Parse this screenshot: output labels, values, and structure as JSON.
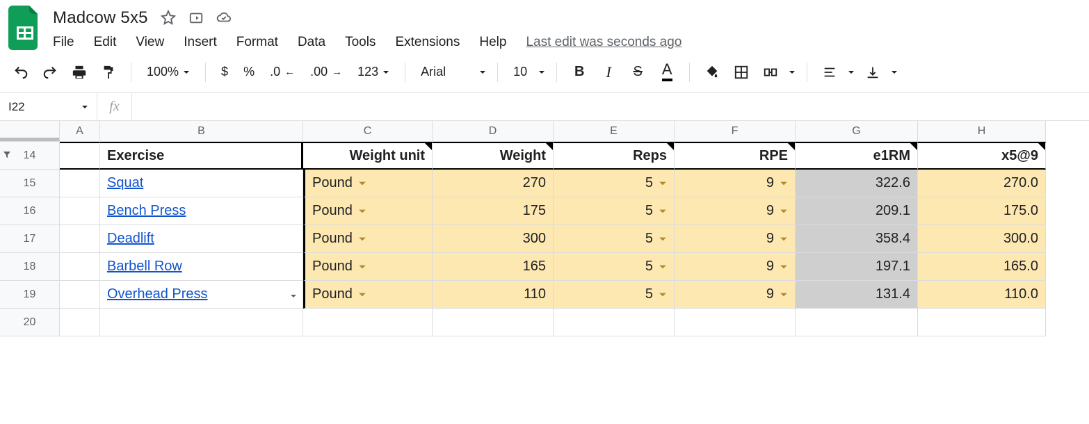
{
  "doc": {
    "title": "Madcow 5x5"
  },
  "menu": {
    "file": "File",
    "edit": "Edit",
    "view": "View",
    "insert": "Insert",
    "format": "Format",
    "data": "Data",
    "tools": "Tools",
    "extensions": "Extensions",
    "help": "Help",
    "last_edit": "Last edit was seconds ago"
  },
  "toolbar": {
    "zoom": "100%",
    "dollar": "$",
    "percent": "%",
    "dec_less": ".0",
    "dec_more": ".00",
    "fmt123": "123",
    "font": "Arial",
    "font_size": "10"
  },
  "namebox": {
    "ref": "I22",
    "fx": "fx"
  },
  "cols": {
    "A": "A",
    "B": "B",
    "C": "C",
    "D": "D",
    "E": "E",
    "F": "F",
    "G": "G",
    "H": "H"
  },
  "rows": {
    "r14": "14",
    "r15": "15",
    "r16": "16",
    "r17": "17",
    "r18": "18",
    "r19": "19",
    "r20": "20"
  },
  "headers": {
    "exercise": "Exercise",
    "unit": "Weight unit",
    "weight": "Weight",
    "reps": "Reps",
    "rpe": "RPE",
    "e1rm": "e1RM",
    "x5": "x5@9"
  },
  "data_rows": [
    {
      "exercise": "Squat",
      "unit": "Pound",
      "weight": "270",
      "reps": "5",
      "rpe": "9",
      "e1rm": "322.6",
      "x5": "270.0"
    },
    {
      "exercise": "Bench Press",
      "unit": "Pound",
      "weight": "175",
      "reps": "5",
      "rpe": "9",
      "e1rm": "209.1",
      "x5": "175.0"
    },
    {
      "exercise": "Deadlift",
      "unit": "Pound",
      "weight": "300",
      "reps": "5",
      "rpe": "9",
      "e1rm": "358.4",
      "x5": "300.0"
    },
    {
      "exercise": "Barbell Row",
      "unit": "Pound",
      "weight": "165",
      "reps": "5",
      "rpe": "9",
      "e1rm": "197.1",
      "x5": "165.0"
    },
    {
      "exercise": "Overhead Press",
      "unit": "Pound",
      "weight": "110",
      "reps": "5",
      "rpe": "9",
      "e1rm": "131.4",
      "x5": "110.0"
    }
  ]
}
